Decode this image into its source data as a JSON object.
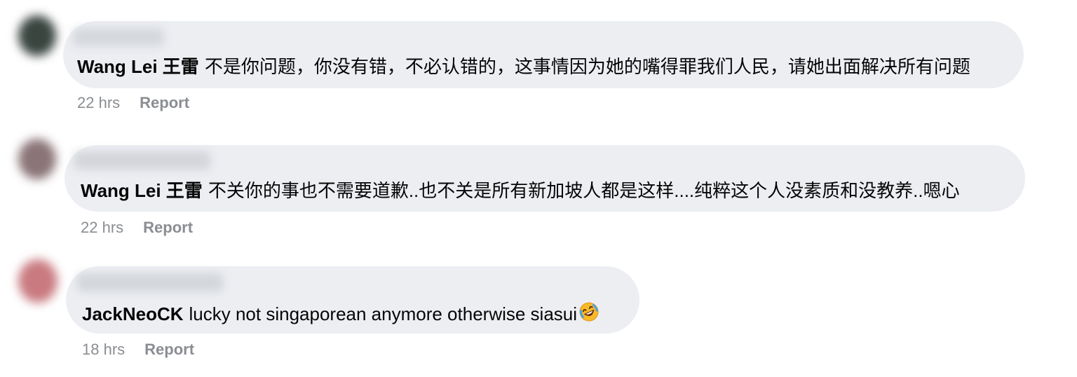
{
  "comments": [
    {
      "author": "Wang Lei 王雷",
      "text": "不是你问题，你没有错，不必认错的，这事情因为她的嘴得罪我们人民，请她出面解决所有问题",
      "time": "22 hrs",
      "action": "Report",
      "avatar_color": "#3a4540"
    },
    {
      "author": "Wang Lei 王雷",
      "text": "不关你的事也不需要道歉..也不关是所有新加坡人都是这样....纯粹这个人没素质和没教养..嗯心",
      "time": "22 hrs",
      "action": "Report",
      "avatar_color": "#8a7478"
    },
    {
      "author": "JackNeoCK",
      "text": "lucky not singaporean anymore otherwise siasui",
      "time": "18 hrs",
      "action": "Report",
      "avatar_color": "#c97a80",
      "emoji": "rolling-on-floor-laughing-icon"
    }
  ],
  "colors": {
    "bubble": "#eceef2",
    "meta_text": "#8a8d91",
    "body_text": "#050505"
  }
}
